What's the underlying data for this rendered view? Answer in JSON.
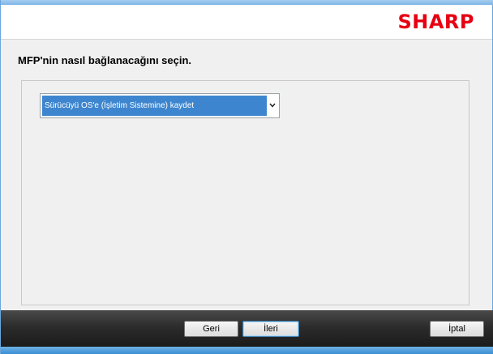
{
  "brand": {
    "logo_text": "SHARP",
    "color": "#e60012"
  },
  "heading": "MFP'nin nasıl bağlanacağını seçin.",
  "connection_select": {
    "selected": "Sürücüyü OS'e (İşletim Sistemine) kaydet",
    "highlight_color": "#3d86cf"
  },
  "footer": {
    "back_label": "Geri",
    "next_label": "İleri",
    "cancel_label": "İptal"
  }
}
